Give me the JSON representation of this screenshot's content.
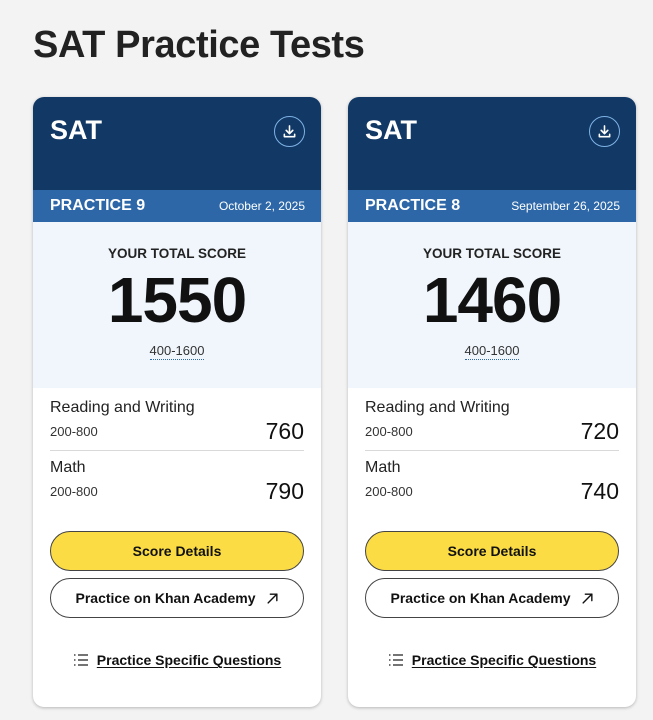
{
  "page": {
    "title": "SAT Practice Tests"
  },
  "cards": [
    {
      "brand": "SAT",
      "practice_label": "PRACTICE 9",
      "date": "October 2, 2025",
      "score_caption": "YOUR TOTAL SCORE",
      "total_score": "1550",
      "score_range": "400-1600",
      "sections": [
        {
          "name": "Reading and Writing",
          "range": "200-800",
          "score": "760"
        },
        {
          "name": "Math",
          "range": "200-800",
          "score": "790"
        }
      ],
      "score_details_label": "Score Details",
      "khan_label": "Practice on Khan Academy",
      "specific_label": "Practice Specific Questions"
    },
    {
      "brand": "SAT",
      "practice_label": "PRACTICE 8",
      "date": "September 26, 2025",
      "score_caption": "YOUR TOTAL SCORE",
      "total_score": "1460",
      "score_range": "400-1600",
      "sections": [
        {
          "name": "Reading and Writing",
          "range": "200-800",
          "score": "720"
        },
        {
          "name": "Math",
          "range": "200-800",
          "score": "740"
        }
      ],
      "score_details_label": "Score Details",
      "khan_label": "Practice on Khan Academy",
      "specific_label": "Practice Specific Questions"
    }
  ],
  "icons": {
    "download": "download-icon",
    "external": "external-link-icon",
    "list": "list-icon"
  },
  "colors": {
    "header_navy": "#123865",
    "band_blue": "#2d67a8",
    "score_bg": "#f0f6fc",
    "button_yellow": "#fbdc44"
  }
}
